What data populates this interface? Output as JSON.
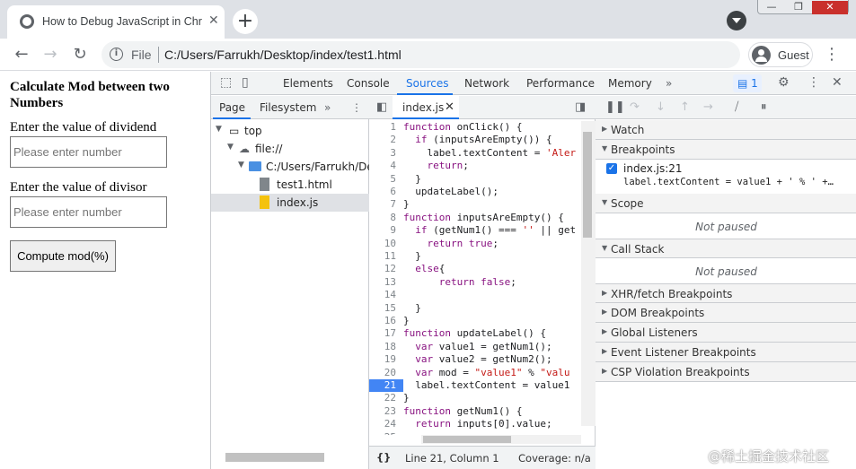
{
  "browser": {
    "tab_title": "How to Debug JavaScript in Chro",
    "tab_close": "✕",
    "new_tab": "+",
    "window_controls": [
      "—",
      "❐",
      "✕"
    ],
    "url_scheme": "File",
    "url": "C:/Users/Farrukh/Desktop/index/test1.html",
    "profile_label": "Guest",
    "back": "←",
    "forward": "→",
    "reload": "↻",
    "info": "i",
    "menu": "⋮"
  },
  "page": {
    "heading": "Calculate Mod between two Numbers",
    "dividend_label": "Enter the value of dividend",
    "dividend_placeholder": "Please enter number",
    "divisor_label": "Enter the value of divisor",
    "divisor_placeholder": "Please enter number",
    "compute_button": "Compute mod(%)"
  },
  "devtools": {
    "tabs": [
      "Elements",
      "Console",
      "Sources",
      "Network",
      "Performance",
      "Memory"
    ],
    "more_tabs": "»",
    "issues_count": "1",
    "navigator_tabs": [
      "Page",
      "Filesystem"
    ],
    "tree": [
      {
        "label": "top",
        "depth": 0
      },
      {
        "label": "file://",
        "depth": 1
      },
      {
        "label": "C:/Users/Farrukh/Desk",
        "depth": 2
      },
      {
        "label": "test1.html",
        "depth": 3
      },
      {
        "label": "index.js",
        "depth": 3
      }
    ],
    "editor_file": "index.js",
    "code": [
      {
        "n": "1",
        "t": "function onClick() {"
      },
      {
        "n": "2",
        "t": "  if (inputsAreEmpty()) {"
      },
      {
        "n": "3",
        "t": "    label.textContent = 'Aler"
      },
      {
        "n": "4",
        "t": "    return;"
      },
      {
        "n": "5",
        "t": "  }"
      },
      {
        "n": "6",
        "t": "  updateLabel();"
      },
      {
        "n": "7",
        "t": "}"
      },
      {
        "n": "8",
        "t": "function inputsAreEmpty() {"
      },
      {
        "n": "9",
        "t": "  if (getNum1() === '' || get"
      },
      {
        "n": "10",
        "t": "    return true;"
      },
      {
        "n": "11",
        "t": "  }"
      },
      {
        "n": "12",
        "t": "  else{"
      },
      {
        "n": "13",
        "t": "      return false;"
      },
      {
        "n": "14",
        "t": ""
      },
      {
        "n": "15",
        "t": "  }"
      },
      {
        "n": "16",
        "t": "}"
      },
      {
        "n": "17",
        "t": "function updateLabel() {"
      },
      {
        "n": "18",
        "t": "  var value1 = getNum1();"
      },
      {
        "n": "19",
        "t": "  var value2 = getNum2();"
      },
      {
        "n": "20",
        "t": "  var mod = \"value1\" % \"valu"
      },
      {
        "n": "21",
        "t": "  label.textContent = value1"
      },
      {
        "n": "22",
        "t": "}"
      },
      {
        "n": "23",
        "t": "function getNum1() {"
      },
      {
        "n": "24",
        "t": "  return inputs[0].value;"
      },
      {
        "n": "25",
        "t": ""
      }
    ],
    "breakpoint_line": "21",
    "status_position": "Line 21, Column 1",
    "status_coverage": "Coverage: n/a",
    "status_braces": "{}",
    "panes": {
      "watch": "Watch",
      "breakpoints": "Breakpoints",
      "bp_location": "index.js:21",
      "bp_code": "label.textContent = value1 + ' % ' +…",
      "scope": "Scope",
      "call_stack": "Call Stack",
      "not_paused": "Not paused",
      "collapsed": [
        "XHR/fetch Breakpoints",
        "DOM Breakpoints",
        "Global Listeners",
        "Event Listener Breakpoints",
        "CSP Violation Breakpoints"
      ]
    }
  },
  "watermark": "@稀土掘金技术社区",
  "colors": {
    "accent": "#1a73e8",
    "breakpoint": "#4285f4",
    "keyword": "#881280",
    "string": "#c41a16"
  }
}
